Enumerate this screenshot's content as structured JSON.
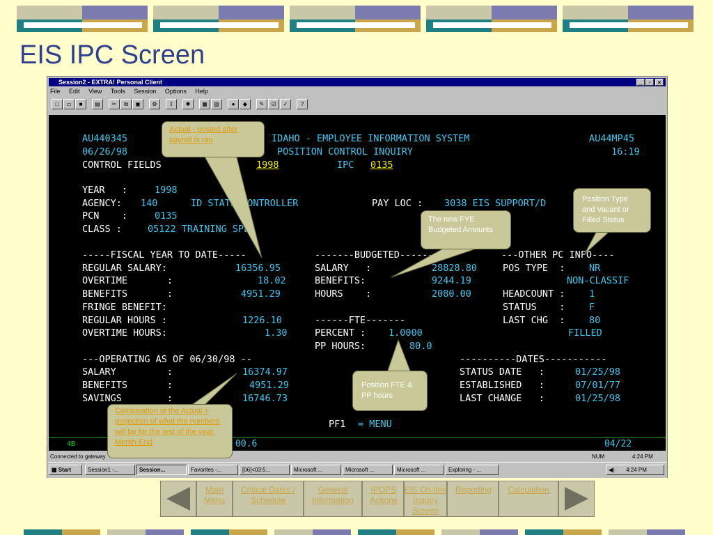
{
  "slide": {
    "title": "EIS IPC Screen"
  },
  "window": {
    "title": "Session2 - EXTRA! Personal Client",
    "controls": [
      "_",
      "▫",
      "×"
    ],
    "menu": [
      "File",
      "Edit",
      "View",
      "Tools",
      "Session",
      "Options",
      "Help"
    ]
  },
  "terminal": {
    "l1a": "AU440345",
    "l1b": "IDAHO - EMPLOYEE INFORMATION SYSTEM",
    "l1c": "AU44MP45",
    "l2a": "06/26/98",
    "l2b": "POSITION CONTROL INQUIRY",
    "l2c": "16:19",
    "l3a": "CONTROL FIELDS",
    "l3b": "1",
    "l3c": "1998",
    "l3d": "IPC",
    "l3e": "0135",
    "year_lbl": "YEAR   :",
    "year_val": "1998",
    "agency_lbl": "AGENCY:",
    "agency_val": "140",
    "agency_name": "ID STATE CONTROLLER",
    "payloc_lbl": "PAY LOC :",
    "payloc_val": "3038 EIS SUPPORT/D",
    "pcn_lbl": "PCN    :",
    "pcn_val": "0135",
    "class_lbl": "CLASS :",
    "class_val": "05122 TRAINING SPEC",
    "h_fytd": "-----FISCAL YEAR TO DATE-----",
    "h_budget": "-------BUDGETED-------",
    "h_other": "---OTHER PC INFO----",
    "reg_sal_lbl": "REGULAR SALARY:",
    "reg_sal_val": "16356.95",
    "b_sal_lbl": "SALARY   :",
    "b_sal_val": "28828.80",
    "postype_lbl": "POS TYPE  :",
    "postype_val": "NR",
    "ot_lbl": "OVERTIME       :",
    "ot_val": "18.02",
    "b_ben_lbl": "BENEFITS:",
    "b_ben_val": "9244.19",
    "nonclass": "NON-CLASSIF",
    "ben_lbl": "BENEFITS       :",
    "ben_val": "4951.29",
    "b_hrs_lbl": "HOURS    :",
    "b_hrs_val": "2080.00",
    "hc_lbl": "HEADCOUNT :",
    "hc_val": "1",
    "fringe_lbl": "FRINGE BENEFIT:",
    "status_lbl": "STATUS    :",
    "status_val": "F",
    "reghrs_lbl": "REGULAR HOURS :",
    "reghrs_val": "1226.10",
    "fte_hdr": "------FTE-------",
    "lastchg_lbl": "LAST CHG  :",
    "lastchg_val": "80",
    "othrs_lbl": "OVERTIME HOURS:",
    "othrs_val": "1.30",
    "pct_lbl": "PERCENT :",
    "pct_val": "1.0000",
    "filled": "FILLED",
    "pphrs_lbl": "PP HOURS:",
    "pphrs_val": "80.0",
    "op_hdr": "---OPERATING AS OF 06/30/98 --",
    "dates_hdr": "----------DATES-----------",
    "op_sal_lbl": "SALARY         :",
    "op_sal_val": "16374.97",
    "sd_lbl": "STATUS DATE   :",
    "sd_val": "01/25/98",
    "op_ben_lbl": "BENEFITS       :",
    "op_ben_val": "4951.29",
    "est_lbl": "ESTABLISHED   :",
    "est_val": "07/01/77",
    "sav_lbl": "SAVINGS        :",
    "sav_val": "16746.73",
    "lc_lbl": "LAST CHANGE   :",
    "lc_val": "01/25/98",
    "pf1": "PF1",
    "pf1_eq": "= MENU",
    "status_left": "4B",
    "status_mid": "00.6",
    "status_right": "04/22"
  },
  "statusbar": {
    "connected": "Connected to gateway",
    "num": "NUM",
    "time": "4:24 PM"
  },
  "taskbar": {
    "start": "Start",
    "tasks": [
      "Session1 -...",
      "Session...",
      "Favorites -...",
      "[06]<03:5...",
      "Microsoft ...",
      "Microsoft ...",
      "Microsoft ...",
      "Exploring - ..."
    ],
    "time": "4:24 PM"
  },
  "callouts": {
    "actual": "Actual - posted after payroll is ran",
    "postype": "Position Type and Vacant or Filled Status",
    "fye": "The new FYE Budgeted Amounts",
    "fte": "Position FTE & PP hours",
    "combo": "Combination of the Actual + projection of what the numbers will be for the rest of the year. Month-End"
  },
  "nav": {
    "main_menu": "Main Menu",
    "critical_dates": "Critical Dates / Schedule",
    "general_info": "General Information",
    "ipops": "IPOPS Actions",
    "eis_online": "EIS On-line Inquiry Screen",
    "reporting": "Reporting",
    "calculation": "Calculation"
  }
}
